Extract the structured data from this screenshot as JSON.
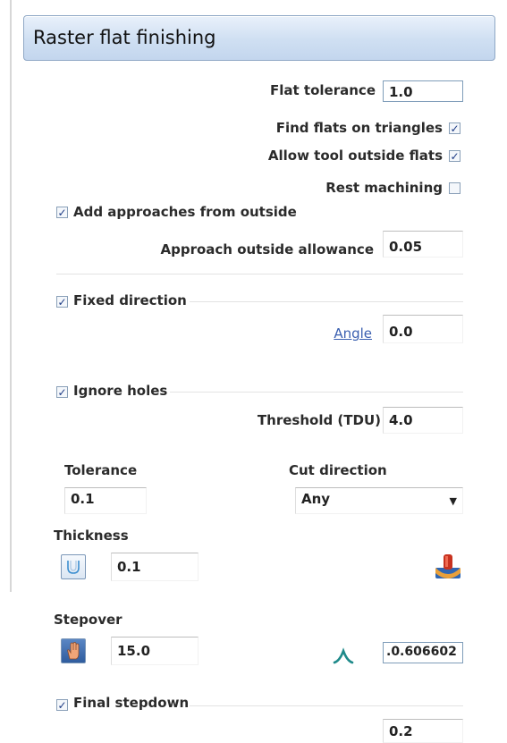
{
  "panel": {
    "title": "Raster flat finishing"
  },
  "flat_tolerance": {
    "label": "Flat tolerance",
    "value": "1.0"
  },
  "find_flats": {
    "label": "Find flats on triangles",
    "checked": true
  },
  "allow_outside": {
    "label": "Allow tool outside flats",
    "checked": true
  },
  "rest_machining": {
    "label": "Rest machining",
    "checked": false
  },
  "approaches": {
    "label": "Add approaches from outside",
    "checked": true
  },
  "approach_allowance": {
    "label": "Approach outside allowance",
    "value": "0.05"
  },
  "fixed_direction": {
    "label": "Fixed direction",
    "checked": true
  },
  "angle": {
    "label": "Angle",
    "value": "0.0"
  },
  "ignore_holes": {
    "label": "Ignore holes",
    "checked": true
  },
  "threshold": {
    "label": "Threshold (TDU)",
    "value": "4.0"
  },
  "tolerance": {
    "label": "Tolerance",
    "value": "0.1"
  },
  "cut_direction": {
    "label": "Cut direction",
    "value": "Any"
  },
  "thickness": {
    "label": "Thickness",
    "value": "0.1"
  },
  "stepover": {
    "label": "Stepover",
    "value": "15.0",
    "computed": ".0.606602"
  },
  "final_stepdown": {
    "label": "Final stepdown",
    "checked": true,
    "value": "0.2"
  },
  "icons": {
    "thickness_button": "tool-profile-icon",
    "thickness_right": "tool-part-icon",
    "stepover_button": "hand-icon",
    "stepover_indicator": "stepover-icon"
  },
  "colors": {
    "header_bg": "#cfdff2",
    "link": "#3a5fb0",
    "check": "#1c3a84"
  }
}
